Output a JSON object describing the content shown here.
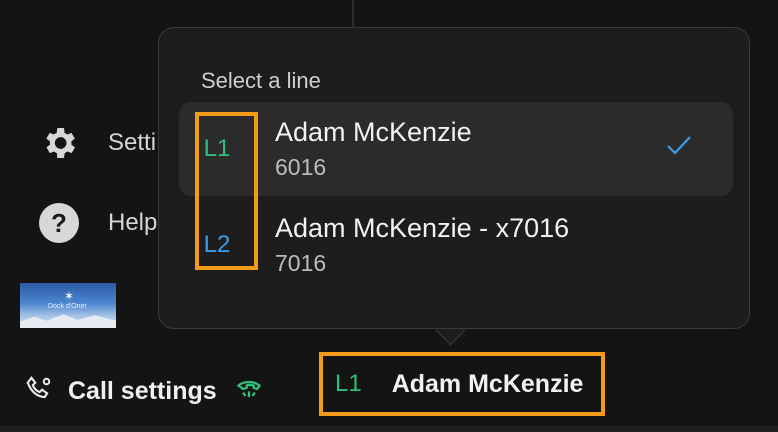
{
  "sidebar": {
    "settings_label": "Setti",
    "help_label": "Help",
    "help_icon_glyph": "?"
  },
  "thumbnail": {
    "caption": "Dock d'Onet"
  },
  "popover": {
    "title": "Select a line",
    "lines": [
      {
        "tag": "L1",
        "name": "Adam McKenzie",
        "extension": "6016",
        "selected": true,
        "tag_color": "#2fbf7a"
      },
      {
        "tag": "L2",
        "name": "Adam McKenzie - x7016",
        "extension": "7016",
        "selected": false,
        "tag_color": "#3c9eea"
      }
    ]
  },
  "bottombar": {
    "call_settings_label": "Call settings",
    "current_line_tag": "L1",
    "current_line_name": "Adam McKenzie"
  },
  "colors": {
    "background": "#141414",
    "popover": "#1d1d1d",
    "selected_row": "#2b2b2b",
    "highlight_border": "#f39c19",
    "l1_green": "#2fbf7a",
    "l2_blue": "#3c9eea",
    "check": "#3c9eea"
  }
}
